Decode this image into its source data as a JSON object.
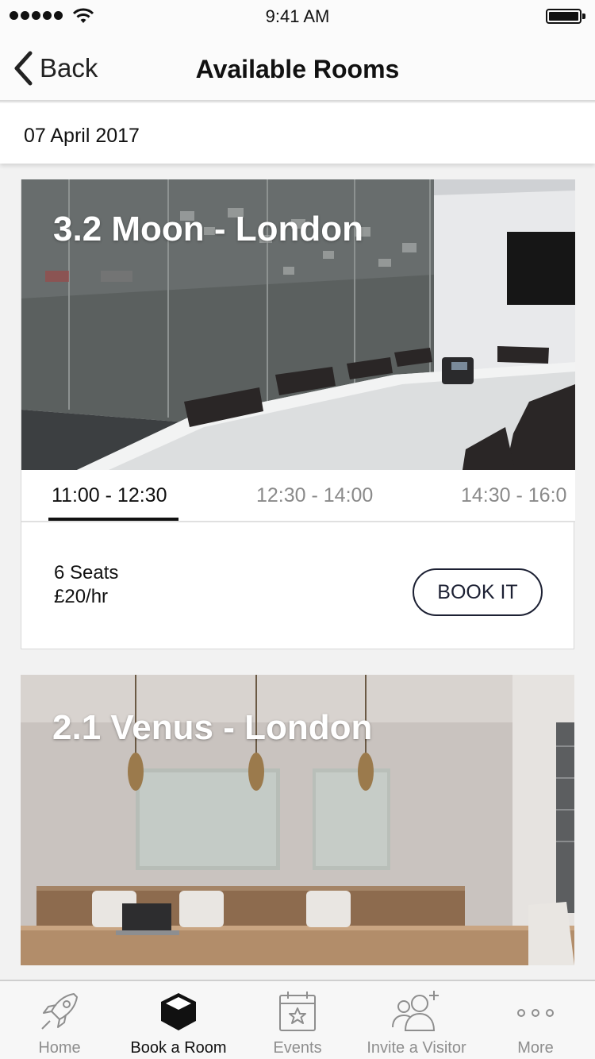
{
  "status_bar": {
    "time": "9:41 AM",
    "icons": [
      "signal-dots-icon",
      "wifi-icon",
      "battery-icon"
    ]
  },
  "nav": {
    "back_label": "Back",
    "back_icon": "chevron-left-icon",
    "title": "Available Rooms"
  },
  "date": "07 April 2017",
  "rooms": [
    {
      "title": "3.2 Moon - London",
      "slots": [
        "11:00 - 12:30",
        "12:30 - 14:00",
        "14:30 - 16:0"
      ],
      "selected_slot": 0,
      "seats": "6 Seats",
      "price": "£20/hr",
      "book_label": "BOOK IT"
    },
    {
      "title": "2.1 Venus - London"
    }
  ],
  "tabs": [
    {
      "label": "Home",
      "icon": "rocket-icon",
      "active": false
    },
    {
      "label": "Book a Room",
      "icon": "cube-icon",
      "active": true
    },
    {
      "label": "Events",
      "icon": "calendar-star-icon",
      "active": false
    },
    {
      "label": "Invite a Visitor",
      "icon": "add-person-icon",
      "active": false
    },
    {
      "label": "More",
      "icon": "more-dots-icon",
      "active": false
    }
  ],
  "colors": {
    "accent": "#1c2033",
    "inactive_text": "#8e8e8e",
    "selected_underline": "#111111",
    "background": "#f2f2f2"
  }
}
